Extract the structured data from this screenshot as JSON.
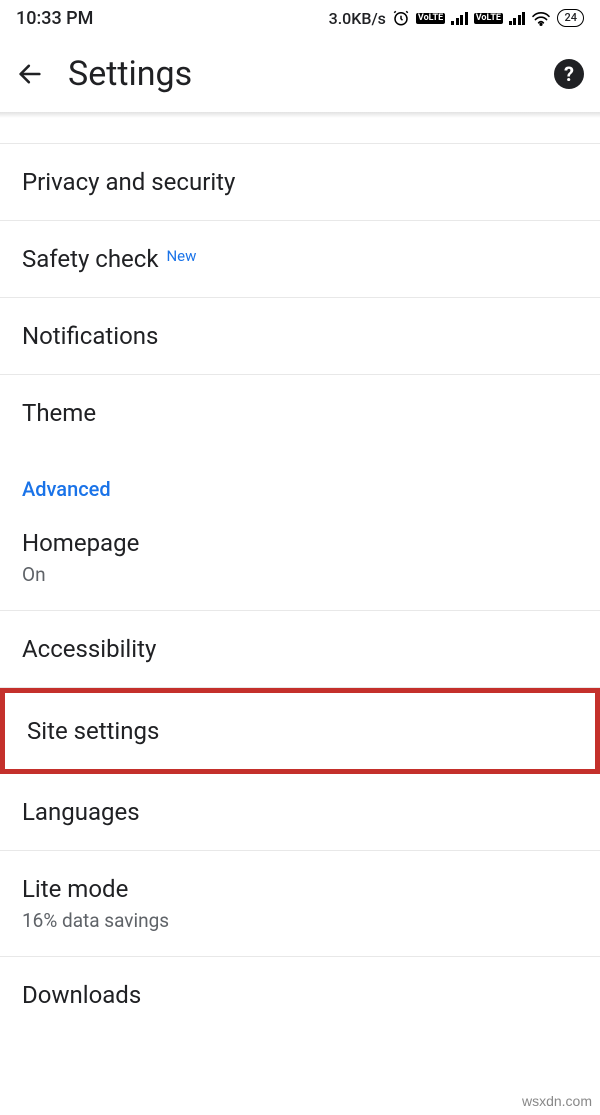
{
  "status": {
    "time": "10:33 PM",
    "speed": "3.0KB/s",
    "vo": "VoLTE",
    "battery": "24"
  },
  "appbar": {
    "title": "Settings"
  },
  "rows": {
    "privacy": "Privacy and security",
    "safety": "Safety check",
    "safety_badge": "New",
    "notifications": "Notifications",
    "theme": "Theme",
    "section_advanced": "Advanced",
    "homepage": "Homepage",
    "homepage_sub": "On",
    "accessibility": "Accessibility",
    "site_settings": "Site settings",
    "languages": "Languages",
    "lite_mode": "Lite mode",
    "lite_mode_sub": "16% data savings",
    "downloads": "Downloads"
  },
  "watermark": "wsxdn.com"
}
